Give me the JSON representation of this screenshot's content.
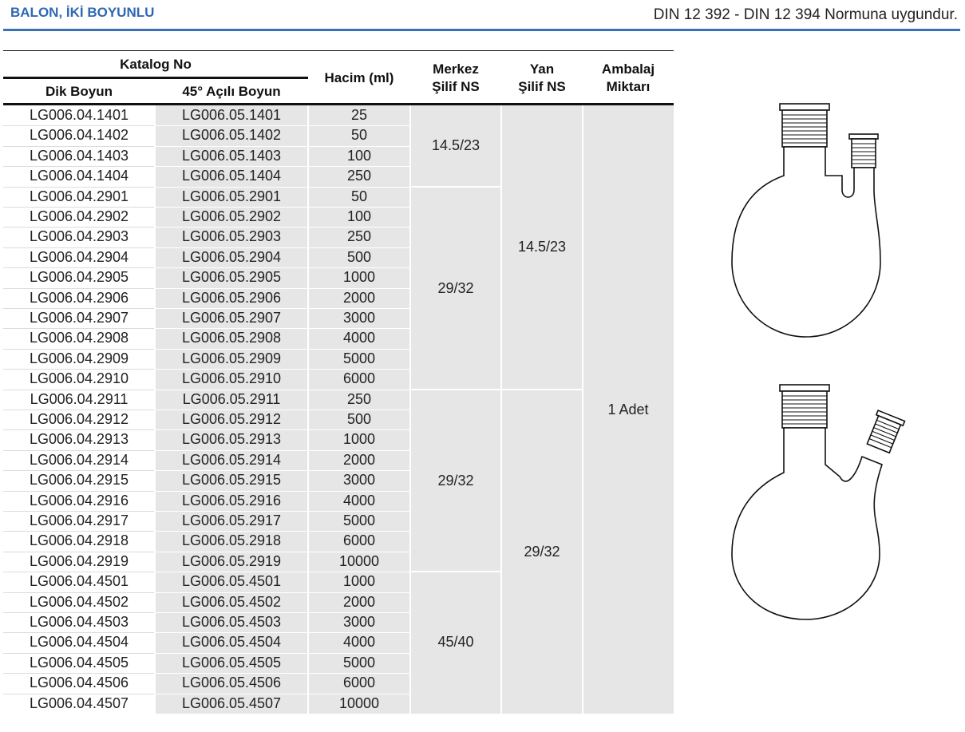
{
  "header": {
    "title": "BALON, İKİ BOYUNLU",
    "norm": "DIN 12 392 - DIN 12 394 Normuna uygundur."
  },
  "table": {
    "headers": {
      "katalog": "Katalog No",
      "dik": "Dik Boyun",
      "acili": "45° Açılı Boyun",
      "hacim": "Hacim (ml)",
      "merkez_1": "Merkez",
      "merkez_2": "Şilif NS",
      "yan_1": "Yan",
      "yan_2": "Şilif NS",
      "ambalaj_1": "Ambalaj",
      "ambalaj_2": "Miktarı"
    },
    "rows": [
      {
        "dik": "LG006.04.1401",
        "acili": "LG006.05.1401",
        "hacim": "25"
      },
      {
        "dik": "LG006.04.1402",
        "acili": "LG006.05.1402",
        "hacim": "50"
      },
      {
        "dik": "LG006.04.1403",
        "acili": "LG006.05.1403",
        "hacim": "100"
      },
      {
        "dik": "LG006.04.1404",
        "acili": "LG006.05.1404",
        "hacim": "250"
      },
      {
        "dik": "LG006.04.2901",
        "acili": "LG006.05.2901",
        "hacim": "50"
      },
      {
        "dik": "LG006.04.2902",
        "acili": "LG006.05.2902",
        "hacim": "100"
      },
      {
        "dik": "LG006.04.2903",
        "acili": "LG006.05.2903",
        "hacim": "250"
      },
      {
        "dik": "LG006.04.2904",
        "acili": "LG006.05.2904",
        "hacim": "500"
      },
      {
        "dik": "LG006.04.2905",
        "acili": "LG006.05.2905",
        "hacim": "1000"
      },
      {
        "dik": "LG006.04.2906",
        "acili": "LG006.05.2906",
        "hacim": "2000"
      },
      {
        "dik": "LG006.04.2907",
        "acili": "LG006.05.2907",
        "hacim": "3000"
      },
      {
        "dik": "LG006.04.2908",
        "acili": "LG006.05.2908",
        "hacim": "4000"
      },
      {
        "dik": "LG006.04.2909",
        "acili": "LG006.05.2909",
        "hacim": "5000"
      },
      {
        "dik": "LG006.04.2910",
        "acili": "LG006.05.2910",
        "hacim": "6000"
      },
      {
        "dik": "LG006.04.2911",
        "acili": "LG006.05.2911",
        "hacim": "250"
      },
      {
        "dik": "LG006.04.2912",
        "acili": "LG006.05.2912",
        "hacim": "500"
      },
      {
        "dik": "LG006.04.2913",
        "acili": "LG006.05.2913",
        "hacim": "1000"
      },
      {
        "dik": "LG006.04.2914",
        "acili": "LG006.05.2914",
        "hacim": "2000"
      },
      {
        "dik": "LG006.04.2915",
        "acili": "LG006.05.2915",
        "hacim": "3000"
      },
      {
        "dik": "LG006.04.2916",
        "acili": "LG006.05.2916",
        "hacim": "4000"
      },
      {
        "dik": "LG006.04.2917",
        "acili": "LG006.05.2917",
        "hacim": "5000"
      },
      {
        "dik": "LG006.04.2918",
        "acili": "LG006.05.2918",
        "hacim": "6000"
      },
      {
        "dik": "LG006.04.2919",
        "acili": "LG006.05.2919",
        "hacim": "10000"
      },
      {
        "dik": "LG006.04.4501",
        "acili": "LG006.05.4501",
        "hacim": "1000"
      },
      {
        "dik": "LG006.04.4502",
        "acili": "LG006.05.4502",
        "hacim": "2000"
      },
      {
        "dik": "LG006.04.4503",
        "acili": "LG006.05.4503",
        "hacim": "3000"
      },
      {
        "dik": "LG006.04.4504",
        "acili": "LG006.05.4504",
        "hacim": "4000"
      },
      {
        "dik": "LG006.04.4505",
        "acili": "LG006.05.4505",
        "hacim": "5000"
      },
      {
        "dik": "LG006.04.4506",
        "acili": "LG006.05.4506",
        "hacim": "6000"
      },
      {
        "dik": "LG006.04.4507",
        "acili": "LG006.05.4507",
        "hacim": "10000"
      }
    ],
    "merkez_groups": [
      {
        "value": "14.5/23",
        "rows": 4
      },
      {
        "value": "29/32",
        "rows": 10
      },
      {
        "value": "29/32",
        "rows": 9
      },
      {
        "value": "45/40",
        "rows": 7
      }
    ],
    "yan_groups": [
      {
        "value": "14.5/23",
        "rows": 14
      },
      {
        "value": "29/32",
        "rows": 16
      }
    ],
    "ambalaj": {
      "value": "1 Adet",
      "rows": 30
    }
  },
  "colors": {
    "accent": "#2f68b3",
    "header_line": "#3b6fb6",
    "cell_gray": "#e6e6e6",
    "cell_white": "#ffffff"
  },
  "icons": [
    "flask-straight-neck-icon",
    "flask-angled-neck-icon"
  ]
}
